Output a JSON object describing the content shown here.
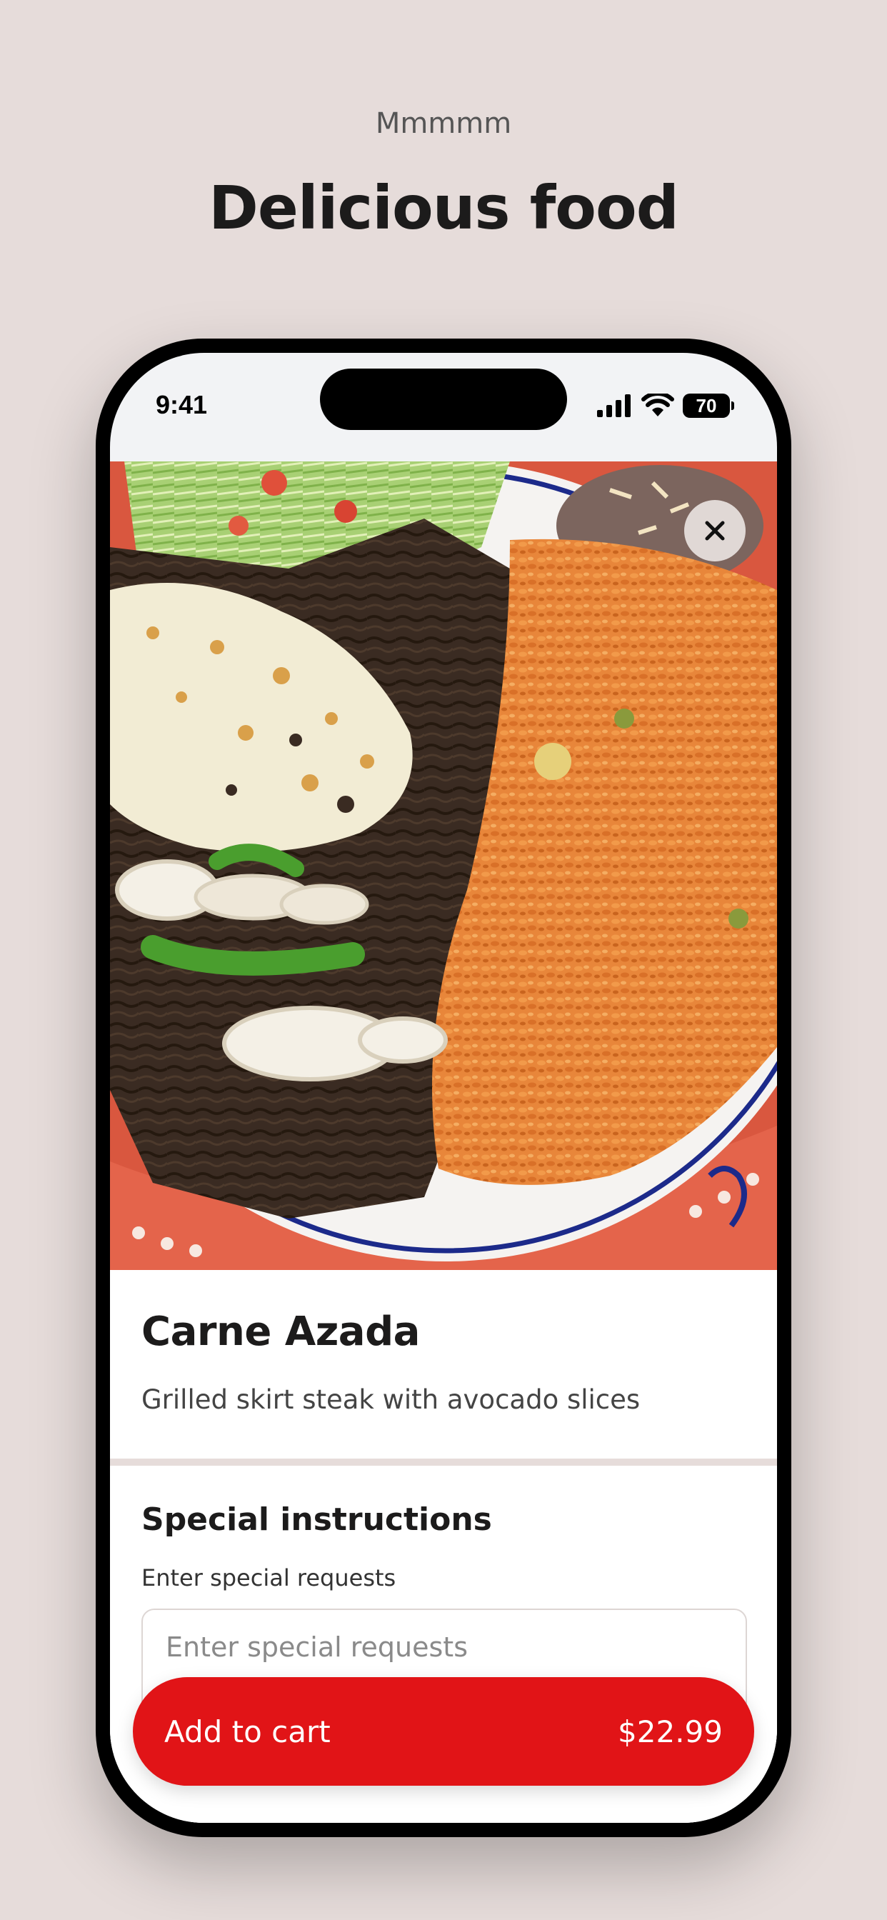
{
  "promo": {
    "eyebrow": "Mmmmm",
    "headline": "Delicious food"
  },
  "status_bar": {
    "time": "9:41",
    "battery": "70",
    "icons": [
      "cellular-signal-icon",
      "wifi-icon",
      "battery-icon"
    ]
  },
  "product": {
    "image": "food-photo-carne-asada-plate",
    "title": "Carne Azada",
    "description": "Grilled skirt steak with avocado slices"
  },
  "special_instructions": {
    "title": "Special instructions",
    "label": "Enter special requests",
    "placeholder": "Enter special requests",
    "value": ""
  },
  "cart": {
    "label": "Add to cart",
    "price": "$22.99"
  },
  "colors": {
    "background": "#e6dcda",
    "accent": "#e11417",
    "text": "#1c1b1b"
  }
}
